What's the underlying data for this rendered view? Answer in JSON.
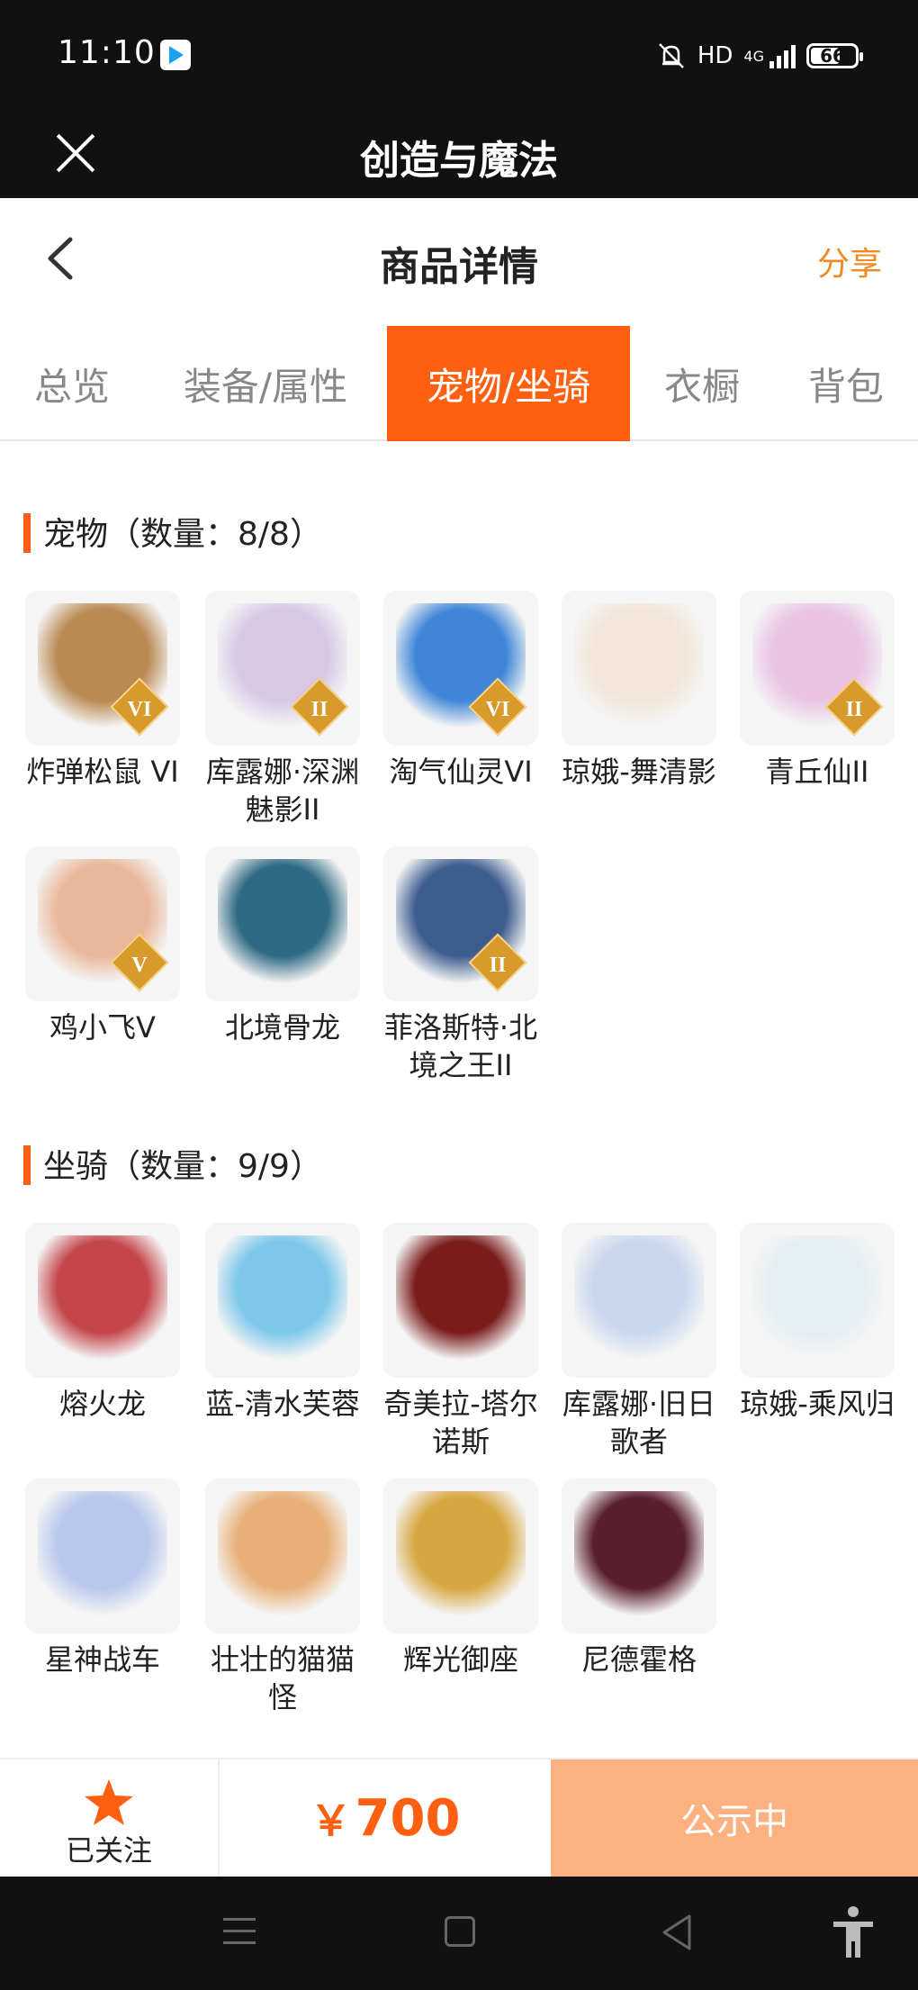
{
  "status_bar": {
    "time": "11:10",
    "network": "HD",
    "network_type": "4G",
    "battery": "66",
    "battery_level": 0.66
  },
  "app_bar": {
    "title": "创造与魔法",
    "close_icon": "close-icon"
  },
  "header": {
    "title": "商品详情",
    "share_label": "分享",
    "accent_color": "#f08a24"
  },
  "tabs": [
    {
      "label": "总览",
      "active": false
    },
    {
      "label": "装备/属性",
      "active": false
    },
    {
      "label": "宠物/坐骑",
      "active": true
    },
    {
      "label": "衣橱",
      "active": false
    },
    {
      "label": "背包",
      "active": false
    }
  ],
  "pets": {
    "title": "宠物（数量：8/8）",
    "items": [
      {
        "name": "炸弹松鼠 VI",
        "badge": "VI",
        "color": "#b98a52"
      },
      {
        "name": "库露娜·深渊魅影II",
        "badge": "II",
        "color": "#d7c8e6"
      },
      {
        "name": "淘气仙灵VI",
        "badge": "VI",
        "color": "#3f86d8"
      },
      {
        "name": "琼娥-舞清影",
        "badge": "",
        "color": "#f2e6d8"
      },
      {
        "name": "青丘仙II",
        "badge": "II",
        "color": "#e9c5e3"
      },
      {
        "name": "鸡小飞V",
        "badge": "V",
        "color": "#e9b79a"
      },
      {
        "name": "北境骨龙",
        "badge": "",
        "color": "#2f6a84"
      },
      {
        "name": "菲洛斯特·北境之王II",
        "badge": "II",
        "color": "#3e5d8f"
      }
    ]
  },
  "mounts": {
    "title": "坐骑（数量：9/9）",
    "items": [
      {
        "name": "熔火龙",
        "badge": "",
        "color": "#c4464b"
      },
      {
        "name": "蓝-清水芙蓉",
        "badge": "",
        "color": "#7cc7ea"
      },
      {
        "name": "奇美拉-塔尔诺斯",
        "badge": "",
        "color": "#7a1c1c"
      },
      {
        "name": "库露娜·旧日歌者",
        "badge": "",
        "color": "#c9d7ee"
      },
      {
        "name": "琼娥-乘风归",
        "badge": "",
        "color": "#e4eef3"
      },
      {
        "name": "星神战车",
        "badge": "",
        "color": "#b7c8ec"
      },
      {
        "name": "壮壮的猫猫怪",
        "badge": "",
        "color": "#e8b078"
      },
      {
        "name": "辉光御座",
        "badge": "",
        "color": "#d6a640"
      },
      {
        "name": "尼德霍格",
        "badge": "",
        "color": "#5a1f2e"
      }
    ]
  },
  "bottom_bar": {
    "follow_label": "已关注",
    "currency": "￥",
    "price": "700",
    "status_label": "公示中",
    "price_color": "#ff5f10",
    "status_color": "#fdb080"
  }
}
